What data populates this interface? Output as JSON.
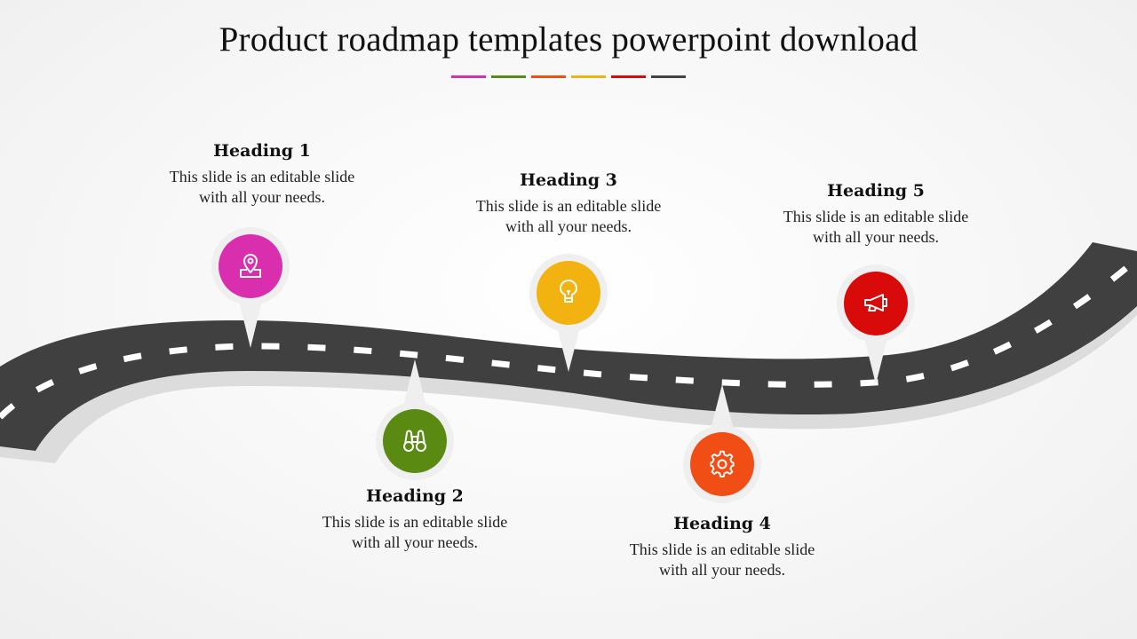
{
  "slide": {
    "title": "Product roadmap templates powerpoint download",
    "accent_bars": [
      "#d92fae",
      "#5a8a12",
      "#f04e14",
      "#f2b20f",
      "#d80a0a",
      "#444444"
    ]
  },
  "road": {
    "color": "#404040",
    "dash_color": "#ffffff",
    "shadow_color": "#dcdcdc"
  },
  "milestones": [
    {
      "heading": "Heading 1",
      "text_line1": "This slide is an editable slide",
      "text_line2": "with all your needs.",
      "icon": "map-location-icon",
      "color": "#d92fae",
      "position": "above"
    },
    {
      "heading": "Heading 2",
      "text_line1": "This slide is an editable slide",
      "text_line2": "with all your needs.",
      "icon": "binoculars-icon",
      "color": "#5a8a12",
      "position": "below"
    },
    {
      "heading": "Heading 3",
      "text_line1": "This slide is an editable slide",
      "text_line2": "with all your needs.",
      "icon": "lightbulb-icon",
      "color": "#f2b20f",
      "position": "above"
    },
    {
      "heading": "Heading 4",
      "text_line1": "This slide is an editable slide",
      "text_line2": "with all your needs.",
      "icon": "gear-icon",
      "color": "#f04e14",
      "position": "below"
    },
    {
      "heading": "Heading 5",
      "text_line1": "This slide is an editable slide",
      "text_line2": "with all your needs.",
      "icon": "megaphone-icon",
      "color": "#d80a0a",
      "position": "above"
    }
  ]
}
